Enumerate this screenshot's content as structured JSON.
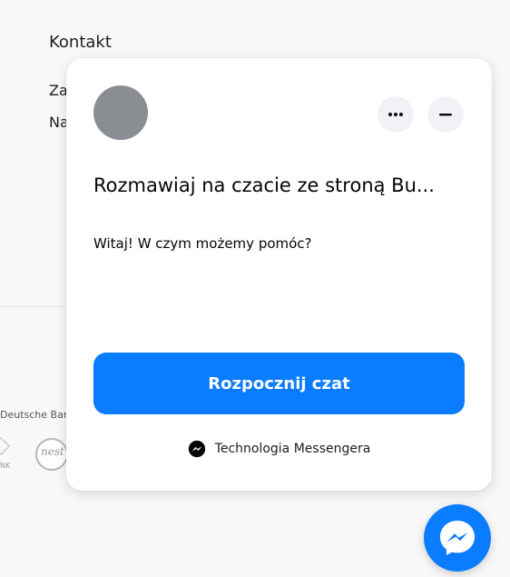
{
  "background_site": {
    "section_heading": "Kontakt",
    "link_1_partial": "Za",
    "link_2_partial": "Na",
    "partner_text": "Deutsche Ban",
    "partner_logo_text_1": "NK",
    "partner_logo_text_2": "nest"
  },
  "chat_widget": {
    "title": "Rozmawiaj na czacie ze stroną Bu...",
    "greeting": "Witaj! W czym możemy pomóc?",
    "start_button_label": "Rozpocznij czat",
    "powered_by": "Technologia Messengera",
    "icons": {
      "more": "more-horizontal-icon",
      "minimize": "minimize-icon",
      "brand": "messenger-icon"
    }
  },
  "colors": {
    "accent": "#0a7cff",
    "avatar_placeholder": "#8a8d91",
    "icon_button_bg": "#f0f2f5"
  }
}
